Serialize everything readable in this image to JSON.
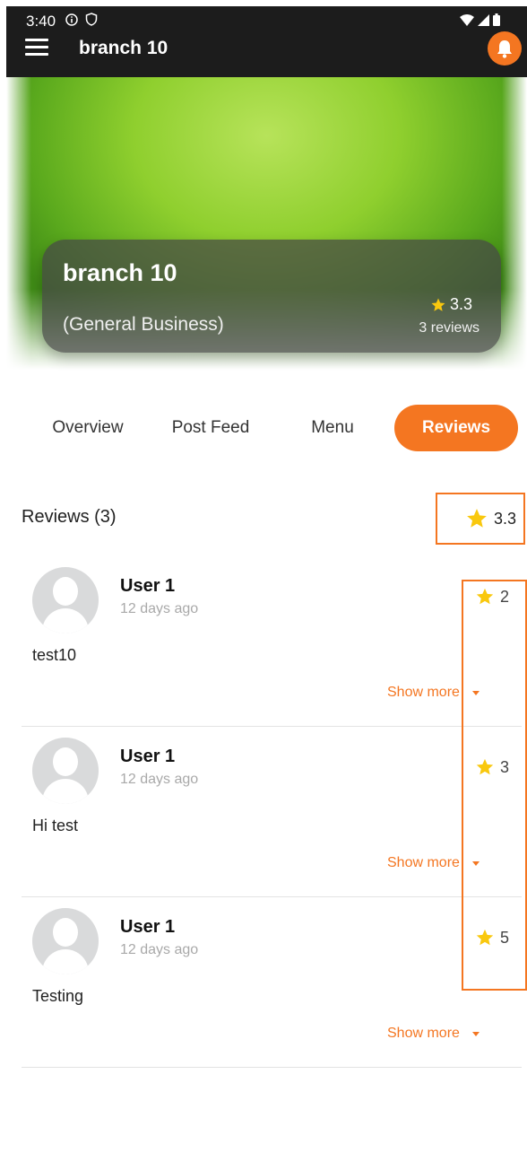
{
  "status_bar": {
    "time": "3:40",
    "icons": [
      "info-icon",
      "shield-icon",
      "wifi-icon",
      "signal-icon",
      "battery-icon"
    ]
  },
  "app_bar": {
    "title": "branch 10",
    "icons": [
      "menu-icon",
      "bell-icon"
    ]
  },
  "hero": {
    "name": "branch 10",
    "category": "(General Business)",
    "rating": "3.3",
    "reviews_count": "3 reviews"
  },
  "tabs": [
    {
      "label": "Overview",
      "active": false
    },
    {
      "label": "Post Feed",
      "active": false
    },
    {
      "label": "Menu",
      "active": false
    },
    {
      "label": "Reviews",
      "active": true
    }
  ],
  "reviews_section": {
    "title": "Reviews (3)",
    "average_rating": "3.3",
    "items": [
      {
        "user": "User 1",
        "time": "12 days ago",
        "rating": "2",
        "text": "test10",
        "show_more": "Show more"
      },
      {
        "user": "User 1",
        "time": "12 days ago",
        "rating": "3",
        "text": "Hi test",
        "show_more": "Show more"
      },
      {
        "user": "User 1",
        "time": "12 days ago",
        "rating": "5",
        "text": "Testing",
        "show_more": "Show more"
      }
    ]
  },
  "colors": {
    "accent": "#f47621",
    "star": "#f9c80e",
    "appbar": "#1c1c1c"
  }
}
